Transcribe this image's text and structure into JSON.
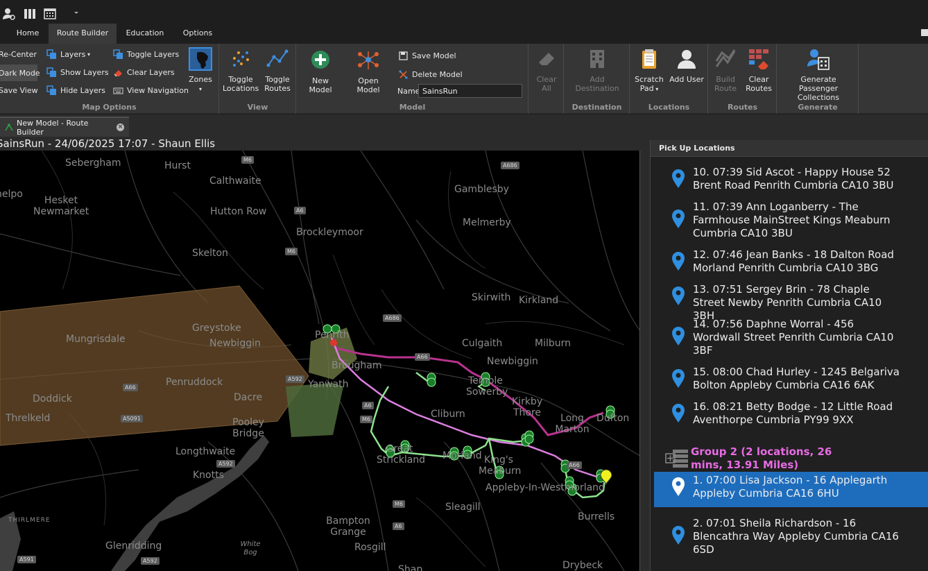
{
  "ribbon_tabs": [
    "Home",
    "Route Builder",
    "Education",
    "Options"
  ],
  "map_options": {
    "recenter": "Re-Center",
    "dark_mode": "Dark Mode",
    "save_view": "Save View",
    "layers": "Layers",
    "show_layers": "Show Layers",
    "hide_layers": "Hide Layers",
    "toggle_layers": "Toggle Layers",
    "clear_layers": "Clear Layers",
    "view_navigation": "View Navigation",
    "zones": "Zones",
    "label": "Map Options"
  },
  "view_group": {
    "toggle_locations": "Toggle Locations",
    "toggle_routes": "Toggle Routes",
    "label": "View"
  },
  "model_group": {
    "new_model": "New Model",
    "open_model": "Open Model",
    "save_model": "Save Model",
    "delete_model": "Delete Model",
    "name_label": "Name",
    "name_value": "SainsRun",
    "label": "Model"
  },
  "clear_all": "Clear All",
  "destination_group": {
    "add_destination": "Add Destination",
    "label": "Destination"
  },
  "locations_group": {
    "scratch_pad": "Scratch Pad",
    "add_user": "Add User",
    "label": "Locations"
  },
  "routes_group": {
    "build_route": "Build Route",
    "clear_routes": "Clear Routes",
    "label": "Routes"
  },
  "generate_group": {
    "generate_collections": "Generate Passenger Collections",
    "label": "Generate"
  },
  "doc_tab": {
    "title": "New Model - Route Builder"
  },
  "map_title": "SainsRun - 24/06/2025 17:07 - Shaun Ellis",
  "map": {
    "places": [
      "Sebergham",
      "Hurst",
      "Calthwaite",
      "Gamblesby",
      "Hesket Newmarket",
      "Hutton Row",
      "Melmerby",
      "Brockleymoor",
      "Skelton",
      "Skirwith",
      "Kirkland",
      "Greystoke",
      "Mungrisdale",
      "Newbiggin",
      "Penrith",
      "Brougham",
      "Culgaith",
      "Milburn",
      "Newbiggin",
      "Penruddock",
      "Yanwath",
      "Temple Sowerby",
      "Doddick",
      "Dacre",
      "Kirkby Thore",
      "Threlkeld",
      "Pooley Bridge",
      "Cliburn",
      "Long Marton",
      "Dufton",
      "Longthwaite",
      "Great Strickland",
      "Morland",
      "King's Meaburn",
      "Knotts",
      "Appleby-In-Westmorland",
      "Sleagill",
      "Burrells",
      "Bampton Grange",
      "Glenridding",
      "White Bog",
      "Rosgill",
      "Drybeck",
      "THIRLMERE",
      "Shap",
      "helpo"
    ],
    "roads": [
      "M6",
      "A686",
      "A6",
      "M6",
      "A686",
      "A66",
      "A592",
      "A66",
      "A5091",
      "A66",
      "A6",
      "M6",
      "A6",
      "M6",
      "A6",
      "A592",
      "A592",
      "A591"
    ]
  },
  "panel": {
    "title": "Pick Up Locations",
    "items": [
      "10.  07:39 Sid Ascot - Happy House 52 Brent Road Penrith Cumbria CA10 3BU",
      "11.  07:39 Ann Loganberry - The Farmhouse MainStreet Kings Meaburn Cumbria CA10 3BU",
      "12.  07:46 Jean Banks - 18 Dalton Road Morland Penrith Cumbria CA10 3BG",
      "13.  07:51 Sergey Brin - 78 Chaple Street Newby Penrith Cumbria CA10 3BH",
      "14.  07:56 Daphne Worral - 456 Wordwall Street Penrith Cumbria CA10 3BF",
      "15.  08:00 Chad Hurley - 1245 Belgariva Bolton Appleby Cumbria CA16 6AK",
      "16.  08:21 Betty Bodge - 12 Little Road Aventhorpe Cumbria PY99 9XX"
    ],
    "group2": "Group 2 (2 locations, 26 mins, 13.91 Miles)",
    "group2_items": [
      "1.  07:00 Lisa Jackson - 16 Applegarth Appleby Cumbria CA16 6HU",
      "2.  07:01 Sheila Richardson - 16 Blencathra Way Appleby Cumbria CA16 6SD"
    ]
  },
  "colors": {
    "accent": "#1e6dbd",
    "group_title": "#e76be4",
    "pin_blue": "#2f8fe0",
    "route_magenta": "#b8338f",
    "route_pink": "#dc7ee0",
    "route_green": "#8fe38f"
  }
}
